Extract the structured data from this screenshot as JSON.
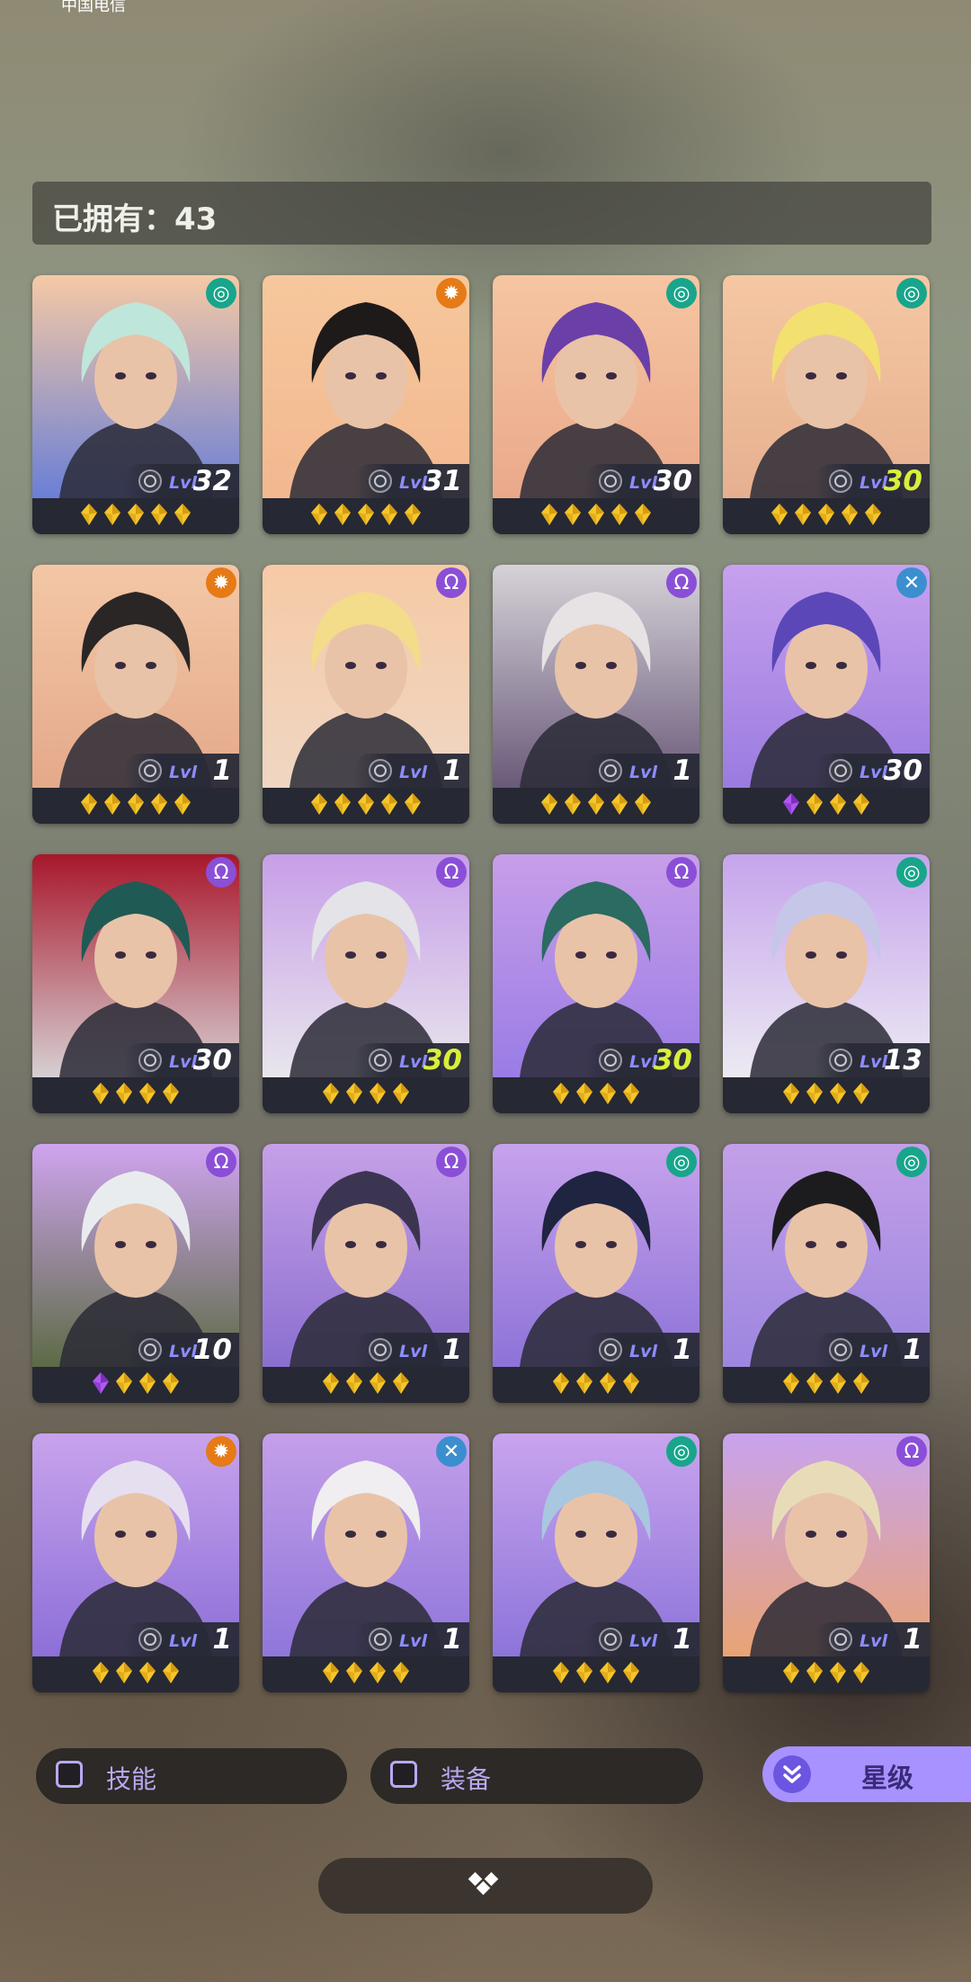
{
  "status_bar": {
    "carrier": "中国电信"
  },
  "owned": {
    "label": "已拥有：",
    "count": "43"
  },
  "colors": {
    "element_spiral": "#18a58b",
    "element_gear": "#e57a17",
    "element_omega": "#8a4fd6",
    "element_cross": "#3b8fcf",
    "level_max": "#d9ef3a",
    "accent": "#a792ff",
    "star_gold": "#f5c62a",
    "star_purple": "#b257f0"
  },
  "heroes": [
    {
      "element": "spiral-icon",
      "element_glyph": "◎",
      "lvl_label": "Lvl",
      "level": "32",
      "max": false,
      "stars": [
        "gold",
        "gold",
        "gold",
        "gold",
        "gold"
      ],
      "bg": [
        "#f5c9a5",
        "#6a7fd6"
      ],
      "hair": "#bfe6da"
    },
    {
      "element": "gear-icon",
      "element_glyph": "✹",
      "lvl_label": "Lvl",
      "level": "31",
      "max": false,
      "stars": [
        "gold",
        "gold",
        "gold",
        "gold",
        "gold"
      ],
      "bg": [
        "#f7c79c",
        "#f2b890"
      ],
      "hair": "#1e1a1a"
    },
    {
      "element": "spiral-icon",
      "element_glyph": "◎",
      "lvl_label": "Lvl",
      "level": "30",
      "max": false,
      "stars": [
        "gold",
        "gold",
        "gold",
        "gold",
        "gold"
      ],
      "bg": [
        "#f6c5a1",
        "#e9a98a"
      ],
      "hair": "#6b3fa8"
    },
    {
      "element": "spiral-icon",
      "element_glyph": "◎",
      "lvl_label": "Lvl",
      "level": "30",
      "max": true,
      "stars": [
        "gold",
        "gold",
        "gold",
        "gold",
        "gold"
      ],
      "bg": [
        "#f5c7a2",
        "#e6b090"
      ],
      "hair": "#f2e070"
    },
    {
      "element": "gear-icon",
      "element_glyph": "✹",
      "lvl_label": "Lvl",
      "level": "1",
      "max": false,
      "stars": [
        "gold",
        "gold",
        "gold",
        "gold",
        "gold"
      ],
      "bg": [
        "#f3c7a6",
        "#e4a98a"
      ],
      "hair": "#2a2626"
    },
    {
      "element": "omega-icon",
      "element_glyph": "Ω",
      "lvl_label": "Lvl",
      "level": "1",
      "max": false,
      "stars": [
        "gold",
        "gold",
        "gold",
        "gold",
        "gold"
      ],
      "bg": [
        "#f6caa5",
        "#efd6c3"
      ],
      "hair": "#f3dc8a"
    },
    {
      "element": "omega-icon",
      "element_glyph": "Ω",
      "lvl_label": "Lvl",
      "level": "1",
      "max": false,
      "stars": [
        "gold",
        "gold",
        "gold",
        "gold",
        "gold"
      ],
      "bg": [
        "#d6d2d8",
        "#6a5a7a"
      ],
      "hair": "#e7e2e4"
    },
    {
      "element": "cross-icon",
      "element_glyph": "✕",
      "lvl_label": "Lvl",
      "level": "30",
      "max": false,
      "stars": [
        "purple",
        "gold",
        "gold",
        "gold"
      ],
      "bg": [
        "#c7a1ee",
        "#9a7be0"
      ],
      "hair": "#5b47b8"
    },
    {
      "element": "omega-icon",
      "element_glyph": "Ω",
      "lvl_label": "Lvl",
      "level": "30",
      "max": false,
      "stars": [
        "gold",
        "gold",
        "gold",
        "gold"
      ],
      "bg": [
        "#a8172b",
        "#d6d0d3"
      ],
      "hair": "#1f5a55"
    },
    {
      "element": "omega-icon",
      "element_glyph": "Ω",
      "lvl_label": "Lvl",
      "level": "30",
      "max": true,
      "stars": [
        "gold",
        "gold",
        "gold",
        "gold"
      ],
      "bg": [
        "#c79ee8",
        "#e8e6ec"
      ],
      "hair": "#e3e3e8"
    },
    {
      "element": "omega-icon",
      "element_glyph": "Ω",
      "lvl_label": "Lvl",
      "level": "30",
      "max": true,
      "stars": [
        "gold",
        "gold",
        "gold",
        "gold"
      ],
      "bg": [
        "#c79ee8",
        "#9a7ce6"
      ],
      "hair": "#2b6b61"
    },
    {
      "element": "spiral-icon",
      "element_glyph": "◎",
      "lvl_label": "Lvl",
      "level": "13",
      "max": false,
      "stars": [
        "gold",
        "gold",
        "gold",
        "gold"
      ],
      "bg": [
        "#c6a4ec",
        "#eceaf2"
      ],
      "hair": "#c6c7e8"
    },
    {
      "element": "omega-icon",
      "element_glyph": "Ω",
      "lvl_label": "Lvl",
      "level": "10",
      "max": false,
      "stars": [
        "purple",
        "gold",
        "gold",
        "gold"
      ],
      "bg": [
        "#cfa4ef",
        "#5c6b45"
      ],
      "hair": "#e9ecef"
    },
    {
      "element": "omega-icon",
      "element_glyph": "Ω",
      "lvl_label": "Lvl",
      "level": "1",
      "max": false,
      "stars": [
        "gold",
        "gold",
        "gold",
        "gold"
      ],
      "bg": [
        "#c6a0e8",
        "#8a6fd0"
      ],
      "hair": "#3c3552"
    },
    {
      "element": "spiral-icon",
      "element_glyph": "◎",
      "lvl_label": "Lvl",
      "level": "1",
      "max": false,
      "stars": [
        "gold",
        "gold",
        "gold",
        "gold"
      ],
      "bg": [
        "#c7a2ec",
        "#8d73d8"
      ],
      "hair": "#1f2440"
    },
    {
      "element": "spiral-icon",
      "element_glyph": "◎",
      "lvl_label": "Lvl",
      "level": "1",
      "max": false,
      "stars": [
        "gold",
        "gold",
        "gold",
        "gold"
      ],
      "bg": [
        "#c39fe7",
        "#9c86e0"
      ],
      "hair": "#1c1c1f"
    },
    {
      "element": "gear-icon",
      "element_glyph": "✹",
      "lvl_label": "Lvl",
      "level": "1",
      "max": false,
      "stars": [
        "gold",
        "gold",
        "gold",
        "gold"
      ],
      "bg": [
        "#c8a3ec",
        "#8c6fd8"
      ],
      "hair": "#e5dff0"
    },
    {
      "element": "cross-icon",
      "element_glyph": "✕",
      "lvl_label": "Lvl",
      "level": "1",
      "max": false,
      "stars": [
        "gold",
        "gold",
        "gold",
        "gold"
      ],
      "bg": [
        "#c49fe9",
        "#8f76db"
      ],
      "hair": "#f0eef0"
    },
    {
      "element": "spiral-icon",
      "element_glyph": "◎",
      "lvl_label": "Lvl",
      "level": "1",
      "max": false,
      "stars": [
        "gold",
        "gold",
        "gold",
        "gold"
      ],
      "bg": [
        "#c9a4ee",
        "#8c74da"
      ],
      "hair": "#a9c7df"
    },
    {
      "element": "omega-icon",
      "element_glyph": "Ω",
      "lvl_label": "Lvl",
      "level": "1",
      "max": false,
      "stars": [
        "gold",
        "gold",
        "gold",
        "gold"
      ],
      "bg": [
        "#c8a3ee",
        "#e9a373"
      ],
      "hair": "#e8dcb8"
    }
  ],
  "filters": {
    "skill": "技能",
    "equipment": "装备",
    "sort": "星级"
  }
}
